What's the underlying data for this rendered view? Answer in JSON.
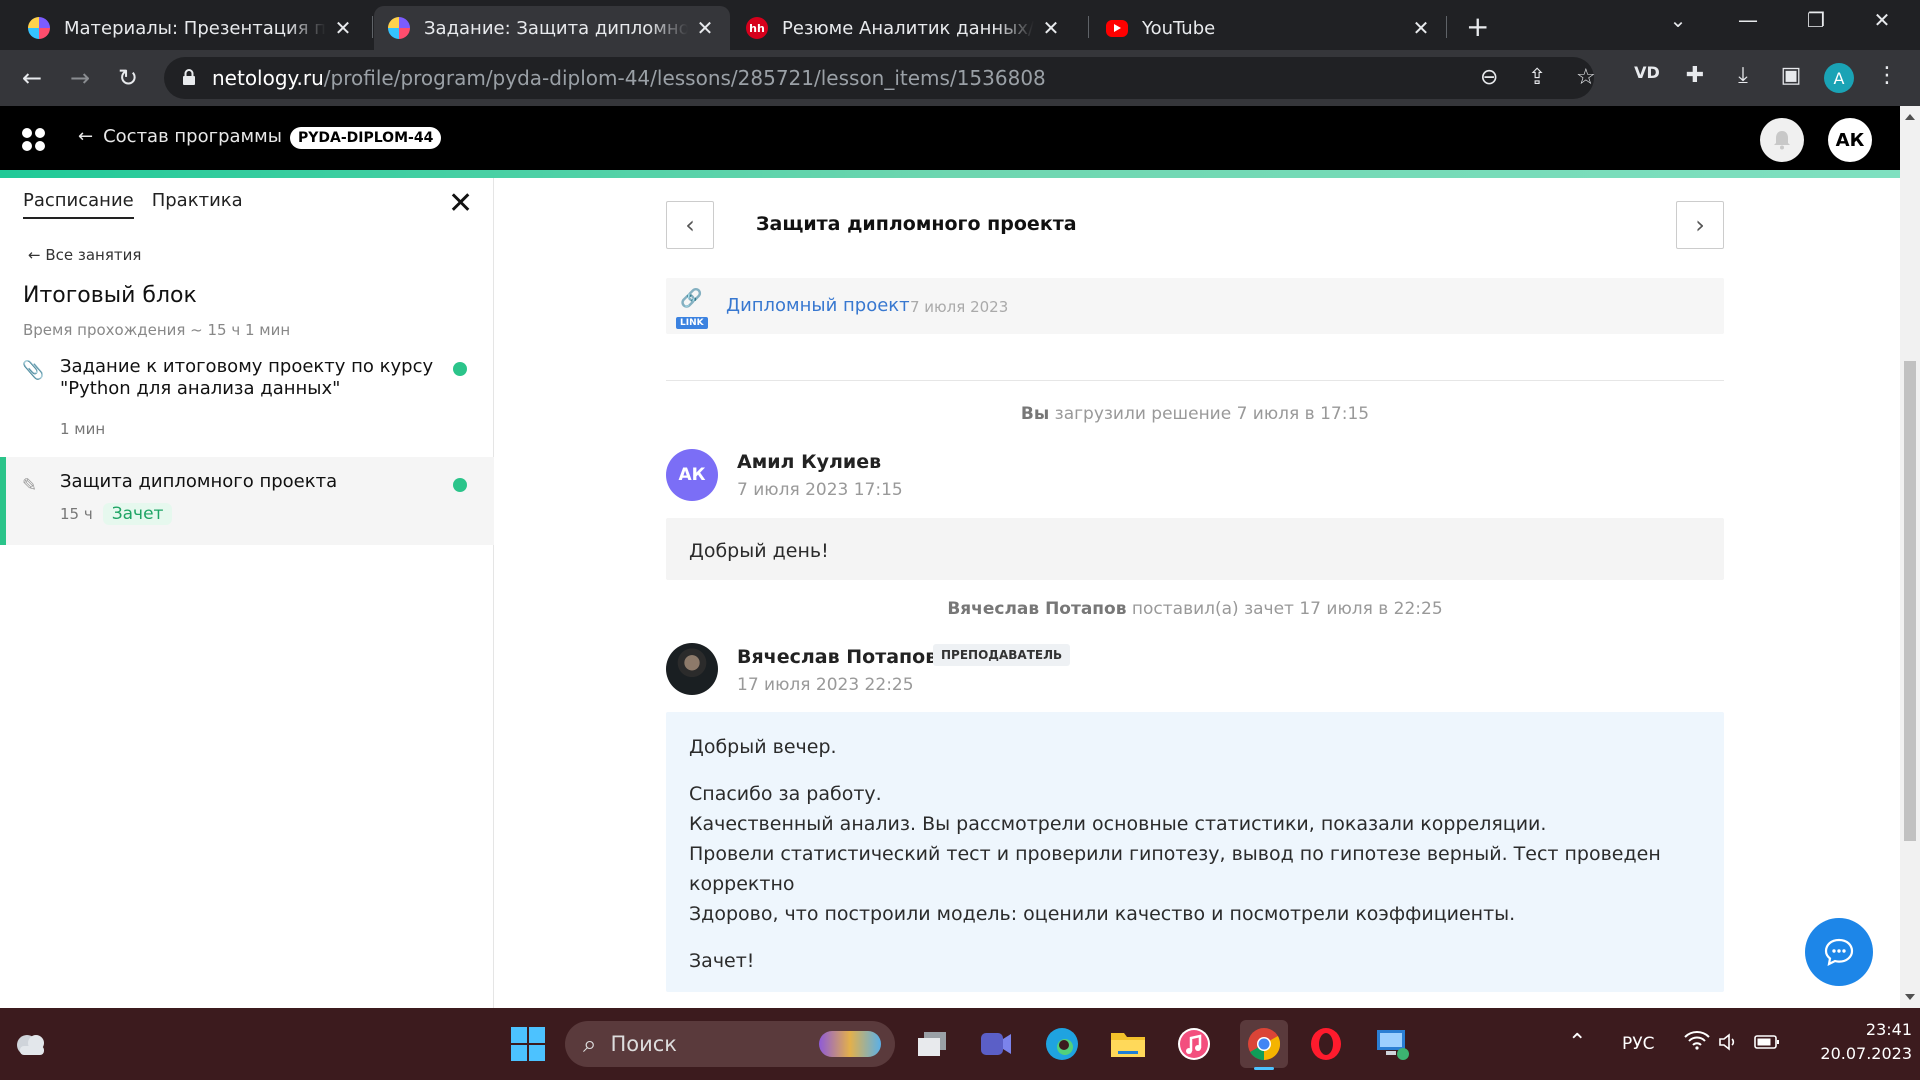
{
  "browser": {
    "tabs": [
      {
        "title": "Материалы: Презентация по теме",
        "active": false
      },
      {
        "title": "Задание: Защита дипломного проекта",
        "active": true
      },
      {
        "title": "Резюме Аналитик данных/Продуктовый аналитик",
        "active": false
      },
      {
        "title": "YouTube",
        "active": false
      }
    ],
    "url_host": "netology.ru",
    "url_path": "/profile/program/pyda-diplom-44/lessons/285721/lesson_items/1536808"
  },
  "header": {
    "back_label": "Состав программы",
    "program_code": "PYDA-DIPLOM-44",
    "user_initials": "АК"
  },
  "sidebar": {
    "tabs": [
      "Расписание",
      "Практика"
    ],
    "all_lessons": "Все занятия",
    "block_title": "Итоговый блок",
    "block_time": "Время прохождения ~ 15 ч 1 мин",
    "lessons": [
      {
        "title": "Задание к итоговому проекту по курсу \"Python для анализа данных\"",
        "duration": "1 мин",
        "badge": "",
        "done": true
      },
      {
        "title": "Защита дипломного проекта",
        "duration": "15 ч",
        "badge": "Зачет",
        "done": true
      }
    ]
  },
  "main": {
    "title": "Защита дипломного проекта",
    "attachment": {
      "tag": "LINK",
      "title": "Дипломный проект",
      "date": "7 июля 2023"
    },
    "events": [
      {
        "actor": "Вы",
        "text": " загрузили решение 7 июля в 17:15"
      },
      {
        "actor": "Вячеслав Потапов",
        "text": " поставил(а) зачет 17 июля в 22:25"
      }
    ],
    "messages": [
      {
        "initials": "АК",
        "author": "Амил Кулиев",
        "date": "7 июля 2023 17:15",
        "role": "",
        "paragraphs": [
          "Добрый день!"
        ]
      },
      {
        "initials": "",
        "author": "Вячеслав Потапов",
        "date": "17 июля 2023 22:25",
        "role": "ПРЕПОДАВАТЕЛЬ",
        "paragraphs": [
          "Добрый вечер.",
          "Спасибо за работу.",
          "Качественный анализ. Вы рассмотрели основные статистики, показали корреляции.",
          "Провели статистический тест и проверили гипотезу, вывод по гипотезе верный. Тест проведен корректно",
          "Здорово, что построили модель: оценили качество и посмотрели коэффициенты.",
          "Зачет!"
        ]
      }
    ]
  },
  "taskbar": {
    "search_placeholder": "Поиск",
    "language": "РУС",
    "time": "23:41",
    "date": "20.07.2023"
  },
  "colors": {
    "accent_green": "#2bc48a",
    "link_blue": "#3878d0",
    "avatar_purple": "#7b6ef6",
    "chat_blue": "#1d86e8"
  }
}
